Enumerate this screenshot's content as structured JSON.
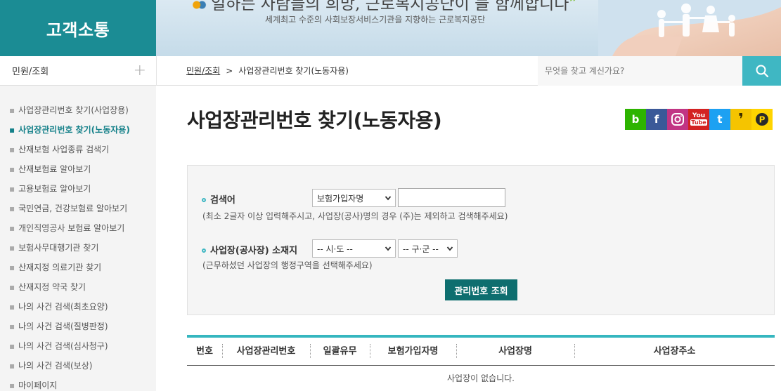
{
  "header": {
    "section_title": "고객소통",
    "slogan": "일하는 사람들의 희망, 근로복지공단이 늘 함께합니다",
    "slogan_close": "”",
    "subslogan": "세계최고 수준의 사회보장서비스기관을 지향하는 근로복지공단"
  },
  "menu_toggle": {
    "label": "민원/조회",
    "icon": "plus-icon"
  },
  "breadcrumb": {
    "items": [
      "민원/조회",
      "사업장관리번호 찾기(노동자용)"
    ],
    "separator": ">"
  },
  "global_search": {
    "placeholder": "무엇을 찾고 계신가요?",
    "value": "",
    "icon": "search-icon"
  },
  "sidebar": {
    "items": [
      {
        "label": "사업장관리번호 찾기(사업장용)",
        "active": false
      },
      {
        "label": "사업장관리번호 찾기(노동자용)",
        "active": true
      },
      {
        "label": "산재보험 사업종류 검색기",
        "active": false
      },
      {
        "label": "산재보험료 알아보기",
        "active": false
      },
      {
        "label": "고용보험료 알아보기",
        "active": false
      },
      {
        "label": "국민연금, 건강보험료 알아보기",
        "active": false
      },
      {
        "label": "개인직영공사 보험료 알아보기",
        "active": false
      },
      {
        "label": "보험사무대행기관 찾기",
        "active": false
      },
      {
        "label": "산재지정 의료기관 찾기",
        "active": false
      },
      {
        "label": "산재지정 약국 찾기",
        "active": false
      },
      {
        "label": "나의 사건 검색(최초요양)",
        "active": false
      },
      {
        "label": "나의 사건 검색(질병판정)",
        "active": false
      },
      {
        "label": "나의 사건 검색(심사청구)",
        "active": false
      },
      {
        "label": "나의 사건 검색(보상)",
        "active": false
      },
      {
        "label": "마이페이지",
        "active": false
      }
    ],
    "bullet": "▪"
  },
  "page": {
    "title": "사업장관리번호 찾기(노동자용)"
  },
  "sns": [
    {
      "name": "blog-icon",
      "glyph": "b",
      "color": "#2db400"
    },
    {
      "name": "facebook-icon",
      "glyph": "f",
      "color": "#3b5998"
    },
    {
      "name": "instagram-icon",
      "glyph": "◎",
      "color": "#c13584"
    },
    {
      "name": "youtube-icon",
      "glyph": "You Tube",
      "color": "#d32222"
    },
    {
      "name": "twitter-icon",
      "glyph": "t",
      "color": "#1da1f2"
    },
    {
      "name": "kakaostory-icon",
      "glyph": "❜",
      "color": "#f5c400"
    },
    {
      "name": "kakaopage-icon",
      "glyph": "P",
      "color": "#ffd400"
    }
  ],
  "form": {
    "keyword": {
      "label": "검색어",
      "select_value": "보험가입자명",
      "input_value": "",
      "hint": "(최소 2글자 이상 입력해주시고, 사업장(공사)명의 경우 (주)는 제외하고 검색해주세요)"
    },
    "location": {
      "label": "사업장(공사장) 소재지",
      "sido_value": "-- 시·도 --",
      "gugun_value": "-- 구·군 --",
      "hint": "(근무하셨던 사업장의 행정구역을 선택해주세요)"
    },
    "submit_label": "관리번호 조회"
  },
  "results": {
    "columns": [
      "번호",
      "사업장관리번호",
      "일괄유무",
      "보험가입자명",
      "사업장명",
      "사업장주소"
    ],
    "empty_message": "사업장이 없습니다."
  },
  "colors": {
    "brand": "#1b8c94",
    "accent": "#3fb7c3",
    "button": "#0e6e6f",
    "active_menu": "#148089"
  }
}
